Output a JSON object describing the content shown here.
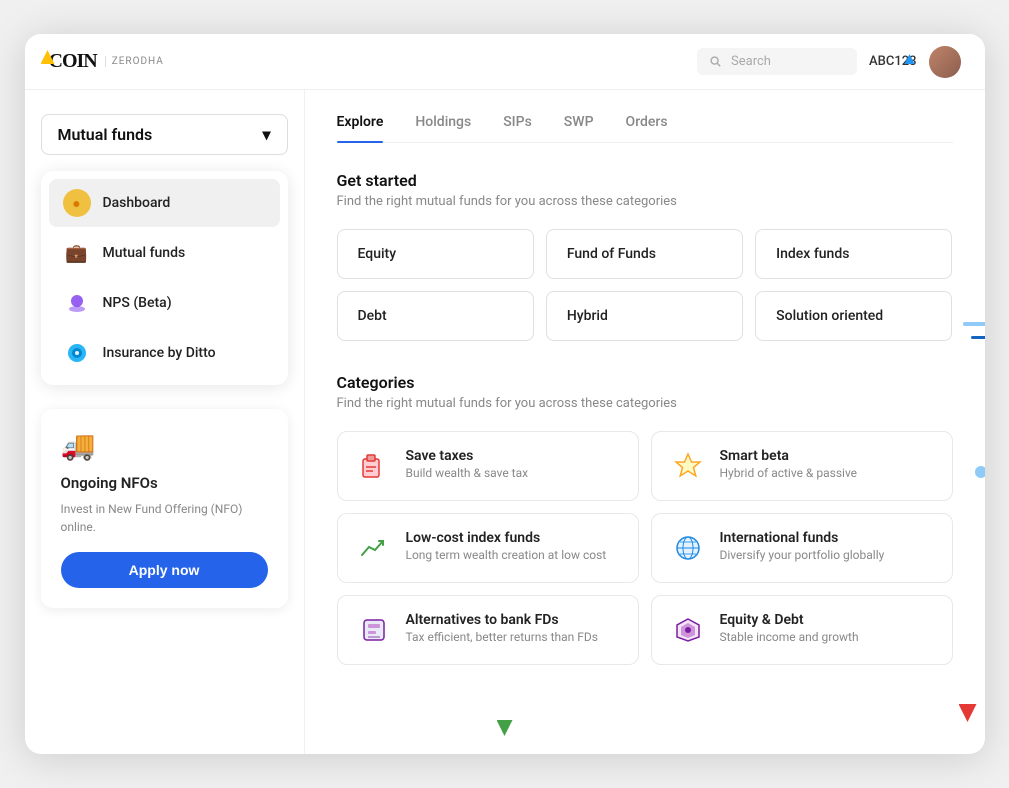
{
  "navbar": {
    "logo_coin": "COIN",
    "logo_zerodha": "ZERODHA",
    "search_placeholder": "Search",
    "user_id": "ABC123"
  },
  "sidebar": {
    "dropdown_label": "Mutual funds",
    "nav_items": [
      {
        "id": "dashboard",
        "label": "Dashboard",
        "icon": "🟠"
      },
      {
        "id": "mutual-funds",
        "label": "Mutual funds",
        "icon": "💼"
      },
      {
        "id": "nps",
        "label": "NPS (Beta)",
        "icon": "🟣"
      },
      {
        "id": "insurance",
        "label": "Insurance by Ditto",
        "icon": "🔵"
      }
    ],
    "nfo_card": {
      "title": "Ongoing NFOs",
      "description": "Invest in New Fund Offering (NFO) online.",
      "apply_label": "Apply now"
    }
  },
  "tabs": [
    {
      "id": "explore",
      "label": "Explore",
      "active": true
    },
    {
      "id": "holdings",
      "label": "Holdings",
      "active": false
    },
    {
      "id": "sips",
      "label": "SIPs",
      "active": false
    },
    {
      "id": "swp",
      "label": "SWP",
      "active": false
    },
    {
      "id": "orders",
      "label": "Orders",
      "active": false
    }
  ],
  "get_started": {
    "title": "Get started",
    "subtitle": "Find the right mutual funds for you across these categories",
    "fund_types": [
      {
        "id": "equity",
        "label": "Equity"
      },
      {
        "id": "fund-of-funds",
        "label": "Fund of Funds"
      },
      {
        "id": "index-funds",
        "label": "Index funds"
      },
      {
        "id": "debt",
        "label": "Debt"
      },
      {
        "id": "hybrid",
        "label": "Hybrid"
      },
      {
        "id": "solution-oriented",
        "label": "Solution oriented"
      }
    ]
  },
  "categories": {
    "title": "Categories",
    "subtitle": "Find the right mutual funds for you across these categories",
    "items": [
      {
        "id": "save-taxes",
        "title": "Save taxes",
        "description": "Build wealth & save tax",
        "icon": "🎁",
        "icon_color": "#e53935"
      },
      {
        "id": "smart-beta",
        "title": "Smart beta",
        "description": "Hybrid of active & passive",
        "icon": "⭐",
        "icon_color": "#f9a825"
      },
      {
        "id": "low-cost-index",
        "title": "Low-cost index funds",
        "description": "Long term wealth creation at low cost",
        "icon": "📈",
        "icon_color": "#43a047"
      },
      {
        "id": "international-funds",
        "title": "International funds",
        "description": "Diversify your portfolio globally",
        "icon": "🌐",
        "icon_color": "#1e88e5"
      },
      {
        "id": "alternatives-fd",
        "title": "Alternatives to bank FDs",
        "description": "Tax efficient, better returns than FDs",
        "icon": "📦",
        "icon_color": "#7b1fa2"
      },
      {
        "id": "equity-debt",
        "title": "Equity & Debt",
        "description": "Stable income and growth",
        "icon": "🛡",
        "icon_color": "#7b1fa2"
      }
    ]
  }
}
